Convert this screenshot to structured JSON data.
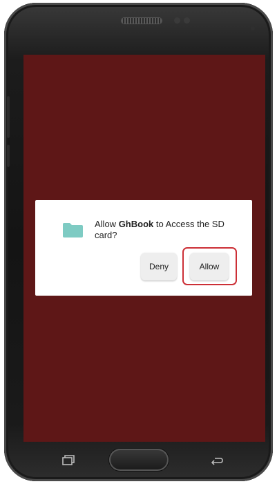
{
  "dialog": {
    "message_prefix": "Allow ",
    "app_name": "GhBook",
    "message_suffix": " to Access the SD card?",
    "deny_label": "Deny",
    "allow_label": "Allow"
  },
  "icons": {
    "folder": "folder-icon",
    "recent_apps": "recent-apps-icon",
    "back": "back-icon"
  },
  "colors": {
    "screen_background": "#5e1717",
    "folder": "#7ecbc3",
    "highlight": "#cc2f36"
  }
}
